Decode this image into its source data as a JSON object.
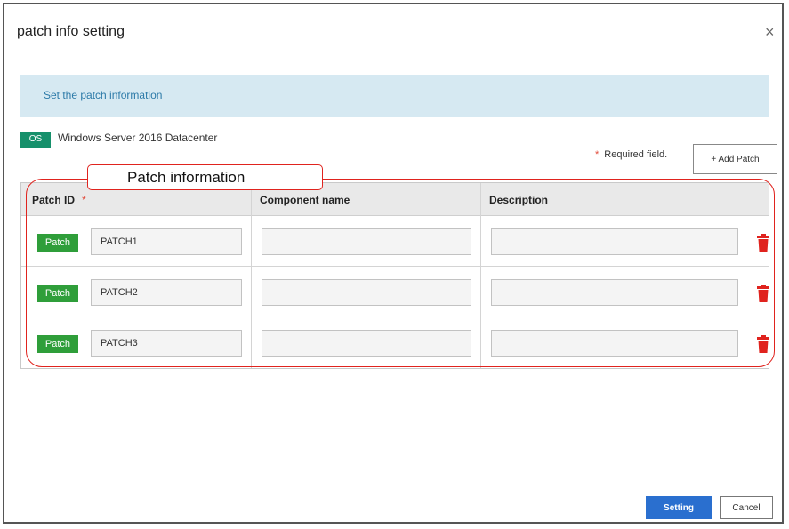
{
  "dialog": {
    "title": "patch info setting",
    "close_glyph": "×",
    "banner_text": "Set the patch information"
  },
  "os": {
    "badge": "OS",
    "name": "Windows Server 2016 Datacenter"
  },
  "required_note": {
    "star": "*",
    "label": "Required field."
  },
  "add_patch_label": "+ Add Patch",
  "callout_label": "Patch information",
  "table": {
    "headers": {
      "patch_id": "Patch ID",
      "patch_id_star": "*",
      "component": "Component name",
      "description": "Description"
    },
    "rows": [
      {
        "badge": "Patch",
        "patch_id": "PATCH1",
        "component": "",
        "description": ""
      },
      {
        "badge": "Patch",
        "patch_id": "PATCH2",
        "component": "",
        "description": ""
      },
      {
        "badge": "Patch",
        "patch_id": "PATCH3",
        "component": "",
        "description": ""
      }
    ]
  },
  "footer": {
    "setting_label": "Setting",
    "cancel_label": "Cancel"
  },
  "colors": {
    "banner_bg": "#d6e9f2",
    "os_badge": "#16906b",
    "patch_badge": "#2f9e3a",
    "primary_button": "#2a6fcf",
    "delete_icon": "#e0231e",
    "required_star": "#e14a3a"
  },
  "icons": {
    "close": "close-icon",
    "delete": "trash-icon"
  }
}
